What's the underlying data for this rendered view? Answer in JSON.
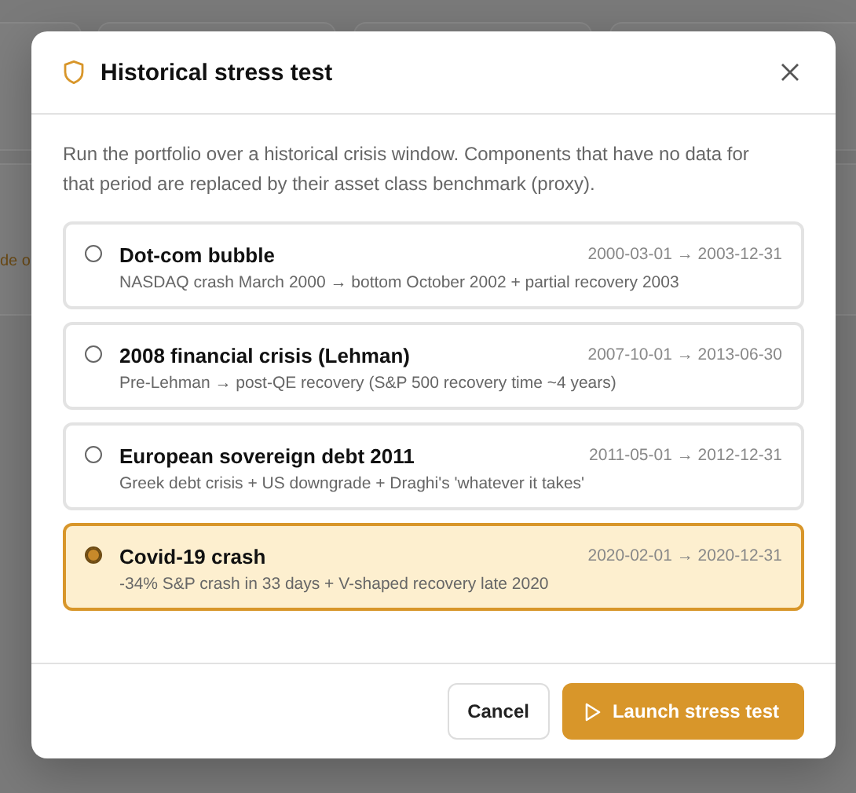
{
  "backdrop": {
    "fragment": "de o"
  },
  "dialog": {
    "title": "Historical stress test",
    "description": "Run the portfolio over a historical crisis window. Components that have no data for that period are replaced by their asset class benchmark (proxy).",
    "scenarios": [
      {
        "name": "Dot-com bubble",
        "range": "2000-03-01 → 2003-12-31",
        "detail": "NASDAQ crash March 2000 → bottom October 2002 + partial recovery 2003",
        "selected": false
      },
      {
        "name": "2008 financial crisis (Lehman)",
        "range": "2007-10-01 → 2013-06-30",
        "detail": "Pre-Lehman → post-QE recovery (S&P 500 recovery time ~4 years)",
        "selected": false
      },
      {
        "name": "European sovereign debt 2011",
        "range": "2011-05-01 → 2012-12-31",
        "detail": "Greek debt crisis + US downgrade + Draghi's 'whatever it takes'",
        "selected": false
      },
      {
        "name": "Covid-19 crash",
        "range": "2020-02-01 → 2020-12-31",
        "detail": "-34% S&P crash in 33 days + V-shaped recovery late 2020",
        "selected": true
      }
    ],
    "buttons": {
      "cancel": "Cancel",
      "launch": "Launch stress test"
    }
  }
}
